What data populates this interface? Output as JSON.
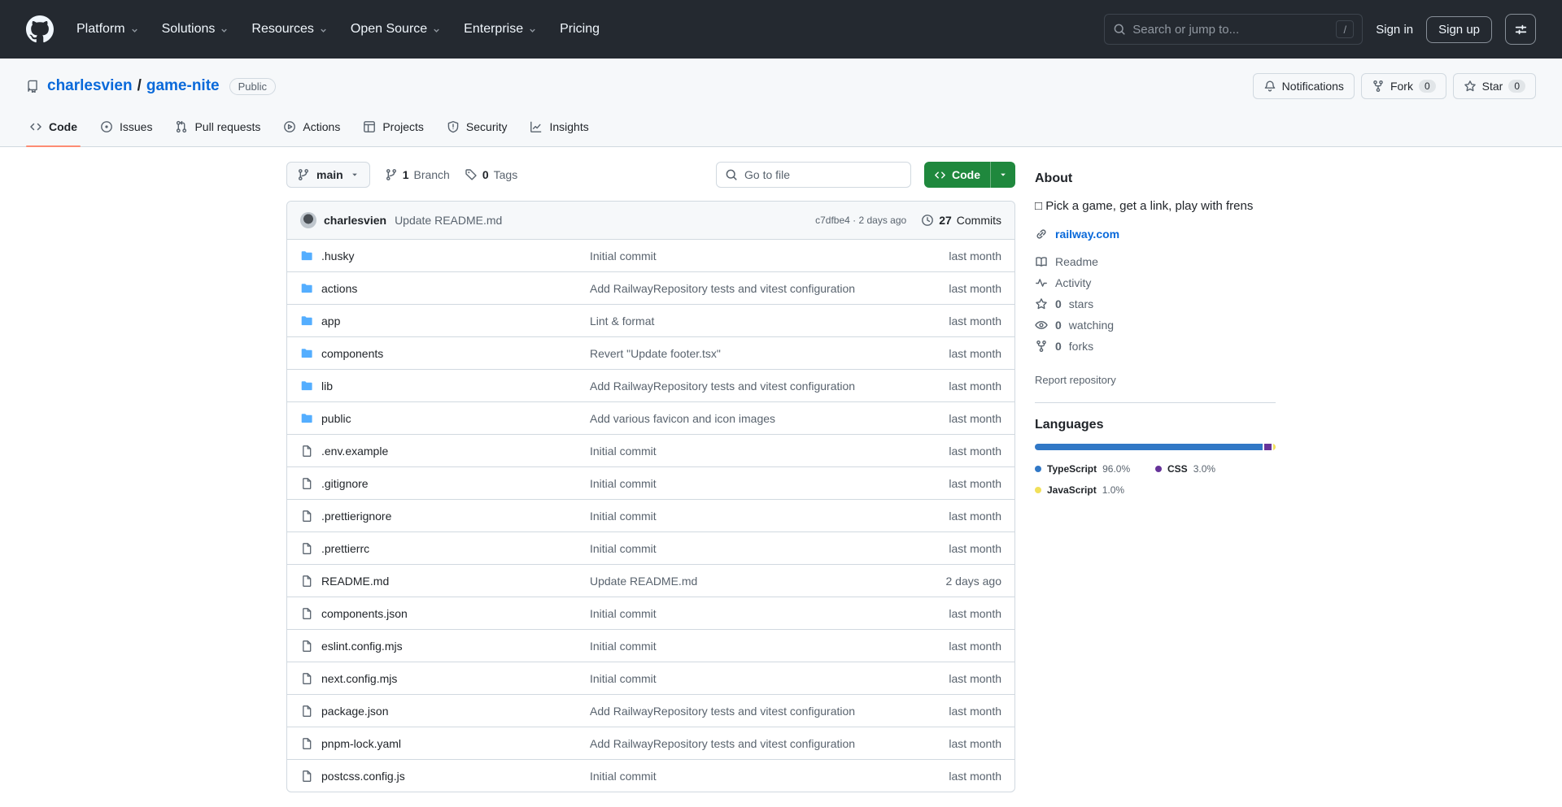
{
  "header": {
    "nav": [
      "Platform",
      "Solutions",
      "Resources",
      "Open Source",
      "Enterprise",
      "Pricing"
    ],
    "search_placeholder": "Search or jump to...",
    "search_shortcut": "/",
    "sign_in": "Sign in",
    "sign_up": "Sign up"
  },
  "repo": {
    "owner": "charlesvien",
    "separator": "/",
    "name": "game-nite",
    "visibility": "Public",
    "notifications_label": "Notifications",
    "fork_label": "Fork",
    "fork_count": "0",
    "star_label": "Star",
    "star_count": "0"
  },
  "tabs": [
    "Code",
    "Issues",
    "Pull requests",
    "Actions",
    "Projects",
    "Security",
    "Insights"
  ],
  "toolbar": {
    "branch": "main",
    "branches_count": "1",
    "branches_label": "Branch",
    "tags_count": "0",
    "tags_label": "Tags",
    "go_to_file": "Go to file",
    "code_button": "Code"
  },
  "commit": {
    "author": "charlesvien",
    "message": "Update README.md",
    "meta": "c7dfbe4 · 2 days ago",
    "count": "27",
    "count_label": "Commits"
  },
  "files": [
    {
      "name": ".husky",
      "type": "folder",
      "message": "Initial commit",
      "date": "last month"
    },
    {
      "name": "actions",
      "type": "folder",
      "message": "Add RailwayRepository tests and vitest configuration",
      "date": "last month"
    },
    {
      "name": "app",
      "type": "folder",
      "message": "Lint & format",
      "date": "last month"
    },
    {
      "name": "components",
      "type": "folder",
      "message": "Revert \"Update footer.tsx\"",
      "date": "last month"
    },
    {
      "name": "lib",
      "type": "folder",
      "message": "Add RailwayRepository tests and vitest configuration",
      "date": "last month"
    },
    {
      "name": "public",
      "type": "folder",
      "message": "Add various favicon and icon images",
      "date": "last month"
    },
    {
      "name": ".env.example",
      "type": "file",
      "message": "Initial commit",
      "date": "last month"
    },
    {
      "name": ".gitignore",
      "type": "file",
      "message": "Initial commit",
      "date": "last month"
    },
    {
      "name": ".prettierignore",
      "type": "file",
      "message": "Initial commit",
      "date": "last month"
    },
    {
      "name": ".prettierrc",
      "type": "file",
      "message": "Initial commit",
      "date": "last month"
    },
    {
      "name": "README.md",
      "type": "file",
      "message": "Update README.md",
      "date": "2 days ago"
    },
    {
      "name": "components.json",
      "type": "file",
      "message": "Initial commit",
      "date": "last month"
    },
    {
      "name": "eslint.config.mjs",
      "type": "file",
      "message": "Initial commit",
      "date": "last month"
    },
    {
      "name": "next.config.mjs",
      "type": "file",
      "message": "Initial commit",
      "date": "last month"
    },
    {
      "name": "package.json",
      "type": "file",
      "message": "Add RailwayRepository tests and vitest configuration",
      "date": "last month"
    },
    {
      "name": "pnpm-lock.yaml",
      "type": "file",
      "message": "Add RailwayRepository tests and vitest configuration",
      "date": "last month"
    },
    {
      "name": "postcss.config.js",
      "type": "file",
      "message": "Initial commit",
      "date": "last month"
    }
  ],
  "about": {
    "title": "About",
    "description": "□ Pick a game, get a link, play with frens",
    "link_text": "railway.com",
    "readme": "Readme",
    "activity": "Activity",
    "stars_count": "0",
    "stars_label": "stars",
    "watching_count": "0",
    "watching_label": "watching",
    "forks_count": "0",
    "forks_label": "forks",
    "report": "Report repository"
  },
  "languages": {
    "title": "Languages",
    "items": [
      {
        "name": "TypeScript",
        "pct": "96.0%",
        "value": 96.0,
        "color": "#3178c6"
      },
      {
        "name": "CSS",
        "pct": "3.0%",
        "value": 3.0,
        "color": "#663399"
      },
      {
        "name": "JavaScript",
        "pct": "1.0%",
        "value": 1.0,
        "color": "#f1e05a"
      }
    ]
  }
}
